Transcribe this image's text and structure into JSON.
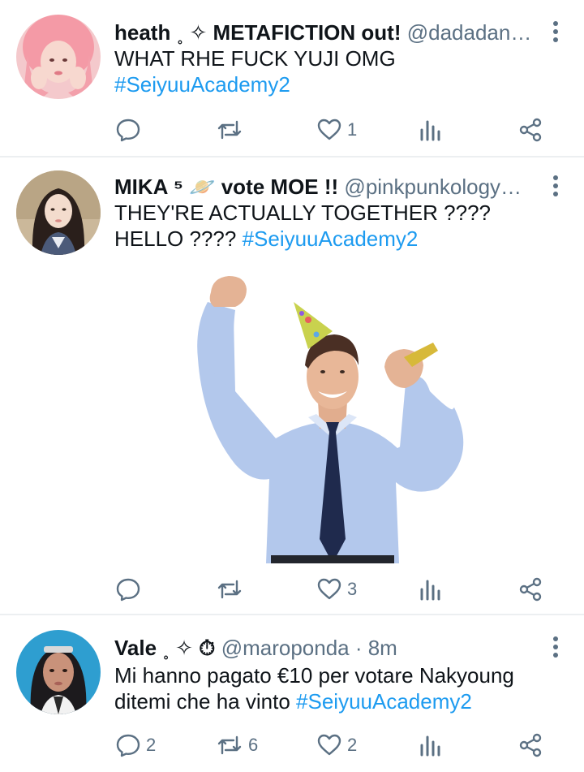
{
  "tweets": [
    {
      "name": "heath ˳ ✧ METAFICTION out!",
      "handle": "@dadadan…",
      "text": "WHAT RHE FUCK YUJI OMG",
      "hashtag": "#SeiyuuAcademy2",
      "counts": {
        "reply": "",
        "retweet": "",
        "like": "1"
      }
    },
    {
      "name": "MIKA ⁵ 🪐 vote MOE !!",
      "handle": "@pinkpunkology…",
      "text": "THEY'RE ACTUALLY TOGETHER ???? HELLO ????",
      "hashtag": "#SeiyuuAcademy2",
      "counts": {
        "reply": "",
        "retweet": "",
        "like": "3"
      }
    },
    {
      "name": "Vale ˳ ✧ ⏱",
      "handle": "@maroponda · 8m",
      "text": "Mi hanno pagato €10 per votare Nakyoung ditemi che ha vinto",
      "hashtag": "#SeiyuuAcademy2",
      "counts": {
        "reply": "2",
        "retweet": "6",
        "like": "2"
      }
    }
  ],
  "icons": {
    "reply": "reply-icon",
    "retweet": "retweet-icon",
    "like": "heart-icon",
    "stats": "stats-icon",
    "share": "share-icon",
    "menu": "more-vertical-icon"
  },
  "colors": {
    "hashtag": "#1d9bf0",
    "icon": "#5b7083",
    "text": "#0f1419"
  }
}
